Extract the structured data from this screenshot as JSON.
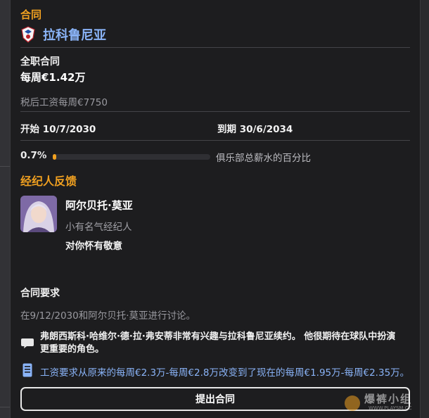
{
  "contract_section": {
    "title": "合同",
    "club_name": "拉科鲁尼亚",
    "contract_type": "全职合同",
    "weekly_wage": "每周€1.42万",
    "after_tax": "税后工资每周€7750",
    "start_label": "开始",
    "start_date": "10/7/2030",
    "end_label": "到期",
    "end_date": "30/6/2034",
    "wage_percent_text": "0.7%",
    "wage_percent_value": 0.7,
    "wage_percent_label": "俱乐部总薪水的百分比"
  },
  "agent_section": {
    "title": "经纪人反馈",
    "agent_name": "阿尔贝托·莫亚",
    "agent_reputation": "小有名气经纪人",
    "attitude": "对你怀有敬意"
  },
  "requirements": {
    "title": "合同要求",
    "discussion": "在9/12/2030和阿尔贝托·莫亚进行讨论。",
    "comment": "弗朗西斯科·哈维尔·德·拉·弗安蒂非常有兴趣与拉科鲁尼亚续约。 他很期待在球队中扮演更重要的角色。",
    "wage_change": "工资要求从原来的每周€2.3万-每周€2.8万改变到了现在的每周€1.95万-每周€2.35万。"
  },
  "actions": {
    "offer_button": "提出合同"
  },
  "watermark": {
    "text": "爆裤小组",
    "url": "WWW.PLAYSM.CC"
  },
  "colors": {
    "accent_orange": "#f0a020",
    "link_blue": "#8ab4f8",
    "panel_bg": "#1d1d1f"
  },
  "icons": [
    "club-crest-icon",
    "speech-bubble-icon",
    "document-icon"
  ]
}
